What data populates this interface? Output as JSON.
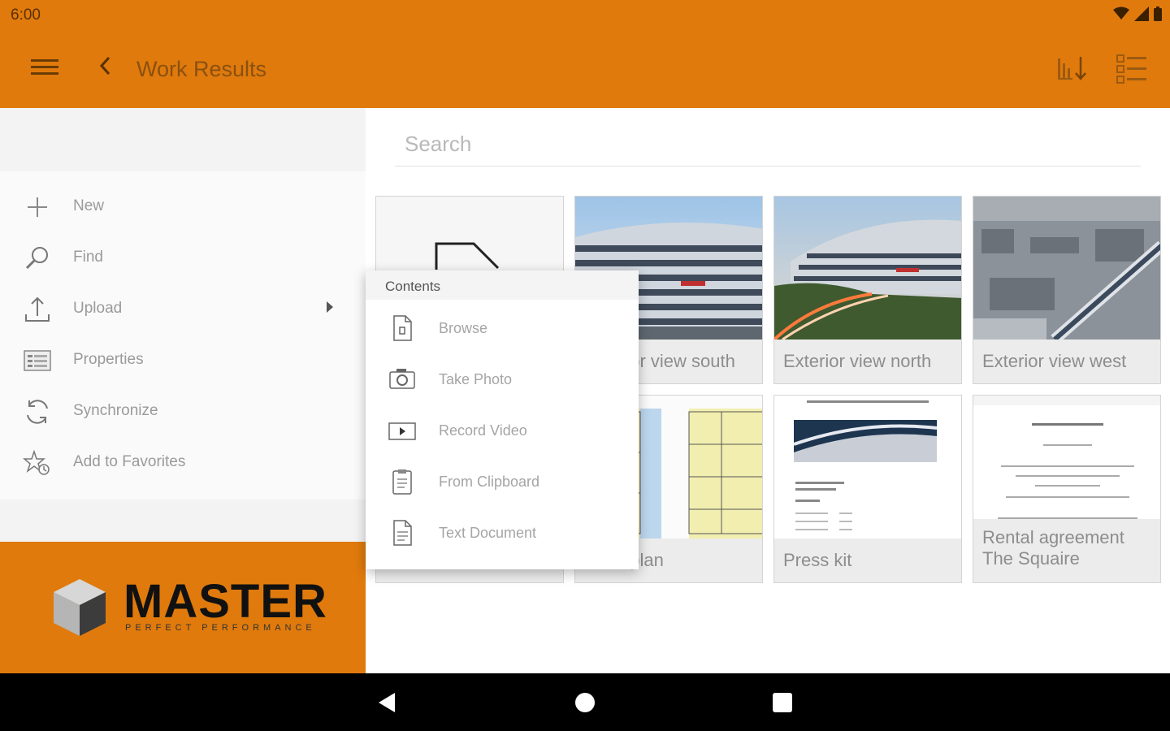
{
  "status_bar": {
    "time": "6:00"
  },
  "app_bar": {
    "title": "Work Results",
    "icons": [
      "menu-icon",
      "back-chevron-icon",
      "sort-icon",
      "list-view-icon"
    ]
  },
  "drawer": {
    "items": [
      {
        "label": "New",
        "icon": "plus-icon"
      },
      {
        "label": "Find",
        "icon": "search-icon"
      },
      {
        "label": "Upload",
        "icon": "upload-icon"
      },
      {
        "label": "Properties",
        "icon": "properties-icon"
      },
      {
        "label": "Synchronize",
        "icon": "sync-icon"
      },
      {
        "label": "Add to Favorites",
        "icon": "favorite-star-icon"
      }
    ],
    "brand": {
      "name": "MASTER",
      "tagline": "PERFECT PERFORMANCE"
    }
  },
  "main": {
    "search": {
      "placeholder": "Search",
      "value": ""
    },
    "tiles": [
      {
        "caption": "",
        "thumb": "new-document"
      },
      {
        "caption": "Exterior view  south",
        "thumb": "building-photo"
      },
      {
        "caption": "Exterior view north",
        "thumb": "building-photo"
      },
      {
        "caption": "Exterior view west",
        "thumb": "aerial-photo"
      },
      {
        "caption": "",
        "thumb": "document"
      },
      {
        "caption": "Floor plan",
        "thumb": "floor-plan"
      },
      {
        "caption": "Press kit",
        "thumb": "document"
      },
      {
        "caption": "Rental agreement The Squaire",
        "thumb": "document"
      }
    ]
  },
  "popup": {
    "title": "Contents",
    "items": [
      {
        "label": "Browse",
        "icon": "file-icon"
      },
      {
        "label": "Take Photo",
        "icon": "camera-icon"
      },
      {
        "label": "Record Video",
        "icon": "video-icon"
      },
      {
        "label": "From Clipboard",
        "icon": "clipboard-icon"
      },
      {
        "label": "Text Document",
        "icon": "text-document-icon"
      }
    ]
  },
  "colors": {
    "brand_orange": "#E07A0C",
    "nav_bar": "#000000"
  }
}
